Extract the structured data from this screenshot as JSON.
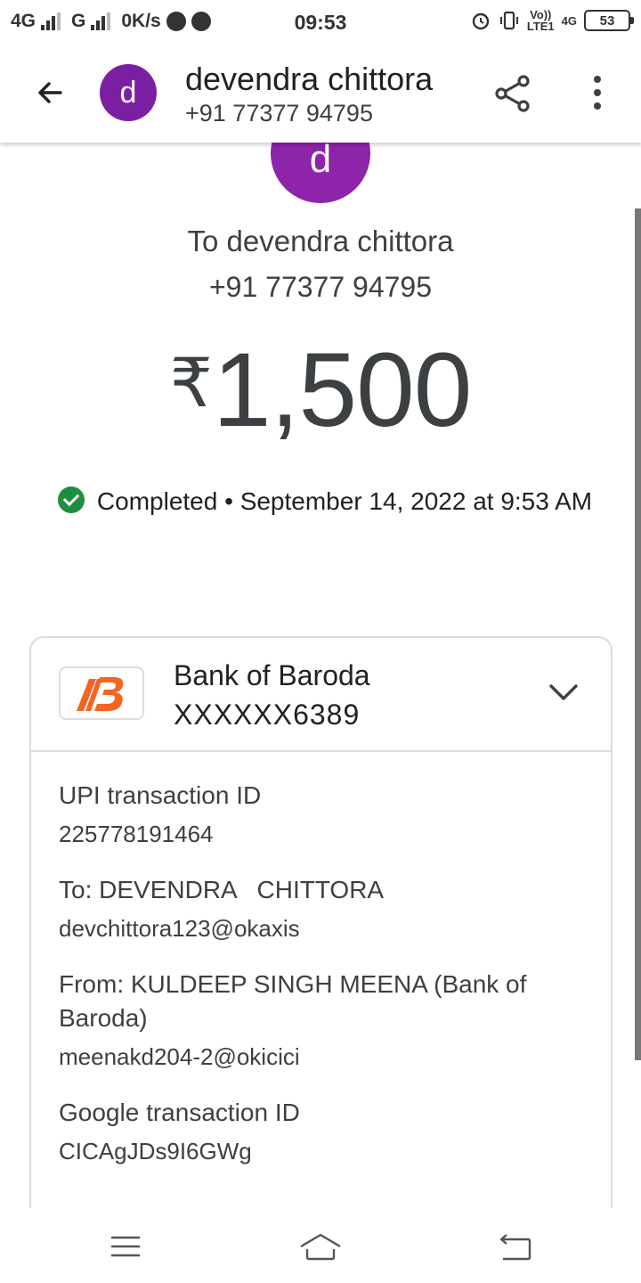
{
  "status_bar": {
    "net1": "4G",
    "net2": "G",
    "speed": "0K/s",
    "time": "09:53",
    "volte": "Vo))",
    "lte": "LTE1",
    "net3": "4G",
    "battery": "53"
  },
  "app_bar": {
    "avatar_letter": "d",
    "name": "devendra chittora",
    "phone": "+91 77377 94795"
  },
  "payment": {
    "avatar_letter": "d",
    "to": "To devendra chittora",
    "phone": "+91 77377 94795",
    "currency": "₹",
    "amount": "1,500",
    "status": "Completed",
    "separator": "•",
    "datetime": "September 14, 2022 at 9:53 AM"
  },
  "card": {
    "bank_name": "Bank of Baroda",
    "account": "XXXXXX6389",
    "fields": [
      {
        "label": "UPI transaction ID",
        "value": "225778191464"
      },
      {
        "label": "To: DEVENDRA   CHITTORA",
        "value": "devchittora123@okaxis"
      },
      {
        "label": "From: KULDEEP SINGH MEENA (Bank of Baroda)",
        "value": "meenakd204-2@okicici"
      },
      {
        "label": "Google transaction ID",
        "value": "CICAgJDs9I6GWg"
      }
    ]
  },
  "colors": {
    "avatar": "#8e24aa",
    "success": "#1e8e3e",
    "bank_brand": "#f26522"
  },
  "icons": [
    "back-arrow-icon",
    "share-icon",
    "more-vert-icon",
    "check-circle-icon",
    "chevron-down-icon",
    "menu-icon",
    "home-icon",
    "back-nav-icon"
  ]
}
